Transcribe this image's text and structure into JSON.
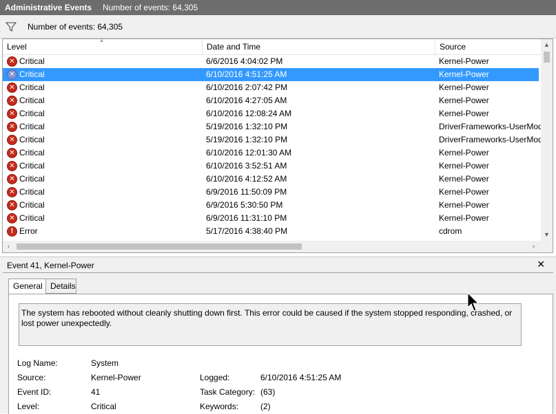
{
  "title": {
    "label": "Administrative Events",
    "count": "Number of events: 64,305"
  },
  "filter": {
    "icon": "filter-icon",
    "text": "Number of events: 64,305"
  },
  "columns": {
    "level": "Level",
    "date": "Date and Time",
    "source": "Source"
  },
  "rows": [
    {
      "level": "Critical",
      "date": "6/6/2016 4:04:02 PM",
      "source": "Kernel-Power",
      "type": "critical",
      "selected": false
    },
    {
      "level": "Critical",
      "date": "6/10/2016 4:51:25 AM",
      "source": "Kernel-Power",
      "type": "critical",
      "selected": true
    },
    {
      "level": "Critical",
      "date": "6/10/2016 2:07:42 PM",
      "source": "Kernel-Power",
      "type": "critical",
      "selected": false
    },
    {
      "level": "Critical",
      "date": "6/10/2016 4:27:05 AM",
      "source": "Kernel-Power",
      "type": "critical",
      "selected": false
    },
    {
      "level": "Critical",
      "date": "6/10/2016 12:08:24 AM",
      "source": "Kernel-Power",
      "type": "critical",
      "selected": false
    },
    {
      "level": "Critical",
      "date": "5/19/2016 1:32:10 PM",
      "source": "DriverFrameworks-UserMod",
      "type": "critical",
      "selected": false
    },
    {
      "level": "Critical",
      "date": "5/19/2016 1:32:10 PM",
      "source": "DriverFrameworks-UserMod",
      "type": "critical",
      "selected": false
    },
    {
      "level": "Critical",
      "date": "6/10/2016 12:01:30 AM",
      "source": "Kernel-Power",
      "type": "critical",
      "selected": false
    },
    {
      "level": "Critical",
      "date": "6/10/2016 3:52:51 AM",
      "source": "Kernel-Power",
      "type": "critical",
      "selected": false
    },
    {
      "level": "Critical",
      "date": "6/10/2016 4:12:52 AM",
      "source": "Kernel-Power",
      "type": "critical",
      "selected": false
    },
    {
      "level": "Critical",
      "date": "6/9/2016 11:50:09 PM",
      "source": "Kernel-Power",
      "type": "critical",
      "selected": false
    },
    {
      "level": "Critical",
      "date": "6/9/2016 5:30:50 PM",
      "source": "Kernel-Power",
      "type": "critical",
      "selected": false
    },
    {
      "level": "Critical",
      "date": "6/9/2016 11:31:10 PM",
      "source": "Kernel-Power",
      "type": "critical",
      "selected": false
    },
    {
      "level": "Error",
      "date": "5/17/2016 4:38:40 PM",
      "source": "cdrom",
      "type": "error",
      "selected": false
    }
  ],
  "detail": {
    "title": "Event 41, Kernel-Power",
    "close": "✕",
    "tabs": {
      "general": "General",
      "details": "Details"
    },
    "message": "The system has rebooted without cleanly shutting down first. This error could be caused if the system stopped responding, crashed, or lost power unexpectedly.",
    "fields": {
      "log_name_label": "Log Name:",
      "log_name": "System",
      "source_label": "Source:",
      "source": "Kernel-Power",
      "logged_label": "Logged:",
      "logged": "6/10/2016 4:51:25 AM",
      "event_id_label": "Event ID:",
      "event_id": "41",
      "task_label": "Task Category:",
      "task": "(63)",
      "level_label": "Level:",
      "level": "Critical",
      "keywords_label": "Keywords:",
      "keywords": "(2)"
    }
  },
  "colors": {
    "selection": "#3399ff",
    "critical": "#c42b1c",
    "titlebar": "#6d6d6d"
  }
}
